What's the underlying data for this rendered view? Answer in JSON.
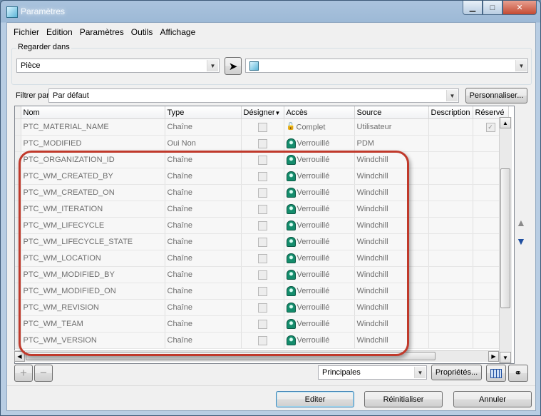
{
  "window": {
    "title": "Paramètres",
    "buttons": {
      "minimize": "▁",
      "maximize": "□",
      "close": "✕"
    }
  },
  "menu": [
    "Fichier",
    "Edition",
    "Paramètres",
    "Outils",
    "Affichage"
  ],
  "lookin": {
    "group_label": "Regarder dans",
    "type_value": "Pièce",
    "model_value": ""
  },
  "filter": {
    "label": "Filtrer par",
    "value": "Par défaut",
    "customize_button": "Personnaliser..."
  },
  "table": {
    "columns": [
      "Nom",
      "Type",
      "Désigner",
      "Accès",
      "Source",
      "Description",
      "Réservé"
    ],
    "rows": [
      {
        "name": "PTC_MATERIAL_NAME",
        "type": "Chaîne",
        "access": "Complet",
        "access_icon": "lock-open-icon",
        "source": "Utilisateur",
        "reserved": true
      },
      {
        "name": "PTC_MODIFIED",
        "type": "Oui Non",
        "access": "Verrouillé",
        "access_icon": "lock-icon",
        "source": "PDM",
        "reserved": false
      },
      {
        "name": "PTC_ORGANIZATION_ID",
        "type": "Chaîne",
        "access": "Verrouillé",
        "access_icon": "lock-icon",
        "source": "Windchill",
        "reserved": false
      },
      {
        "name": "PTC_WM_CREATED_BY",
        "type": "Chaîne",
        "access": "Verrouillé",
        "access_icon": "lock-icon",
        "source": "Windchill",
        "reserved": false
      },
      {
        "name": "PTC_WM_CREATED_ON",
        "type": "Chaîne",
        "access": "Verrouillé",
        "access_icon": "lock-icon",
        "source": "Windchill",
        "reserved": false
      },
      {
        "name": "PTC_WM_ITERATION",
        "type": "Chaîne",
        "access": "Verrouillé",
        "access_icon": "lock-icon",
        "source": "Windchill",
        "reserved": false
      },
      {
        "name": "PTC_WM_LIFECYCLE",
        "type": "Chaîne",
        "access": "Verrouillé",
        "access_icon": "lock-icon",
        "source": "Windchill",
        "reserved": false
      },
      {
        "name": "PTC_WM_LIFECYCLE_STATE",
        "type": "Chaîne",
        "access": "Verrouillé",
        "access_icon": "lock-icon",
        "source": "Windchill",
        "reserved": false
      },
      {
        "name": "PTC_WM_LOCATION",
        "type": "Chaîne",
        "access": "Verrouillé",
        "access_icon": "lock-icon",
        "source": "Windchill",
        "reserved": false
      },
      {
        "name": "PTC_WM_MODIFIED_BY",
        "type": "Chaîne",
        "access": "Verrouillé",
        "access_icon": "lock-icon",
        "source": "Windchill",
        "reserved": false
      },
      {
        "name": "PTC_WM_MODIFIED_ON",
        "type": "Chaîne",
        "access": "Verrouillé",
        "access_icon": "lock-icon",
        "source": "Windchill",
        "reserved": false
      },
      {
        "name": "PTC_WM_REVISION",
        "type": "Chaîne",
        "access": "Verrouillé",
        "access_icon": "lock-icon",
        "source": "Windchill",
        "reserved": false
      },
      {
        "name": "PTC_WM_TEAM",
        "type": "Chaîne",
        "access": "Verrouillé",
        "access_icon": "lock-icon",
        "source": "Windchill",
        "reserved": false
      },
      {
        "name": "PTC_WM_VERSION",
        "type": "Chaîne",
        "access": "Verrouillé",
        "access_icon": "lock-icon",
        "source": "Windchill",
        "reserved": false
      }
    ]
  },
  "bottom_bar": {
    "add": "+",
    "remove": "−",
    "view_select": "Principales",
    "properties_button": "Propriétés..."
  },
  "footer": {
    "edit": "Editer",
    "reset": "Réinitialiser",
    "cancel": "Annuler"
  },
  "colors": {
    "highlight": "#c0392b",
    "lock_green": "#148c6c",
    "arrow_blue": "#1f4fa0"
  }
}
